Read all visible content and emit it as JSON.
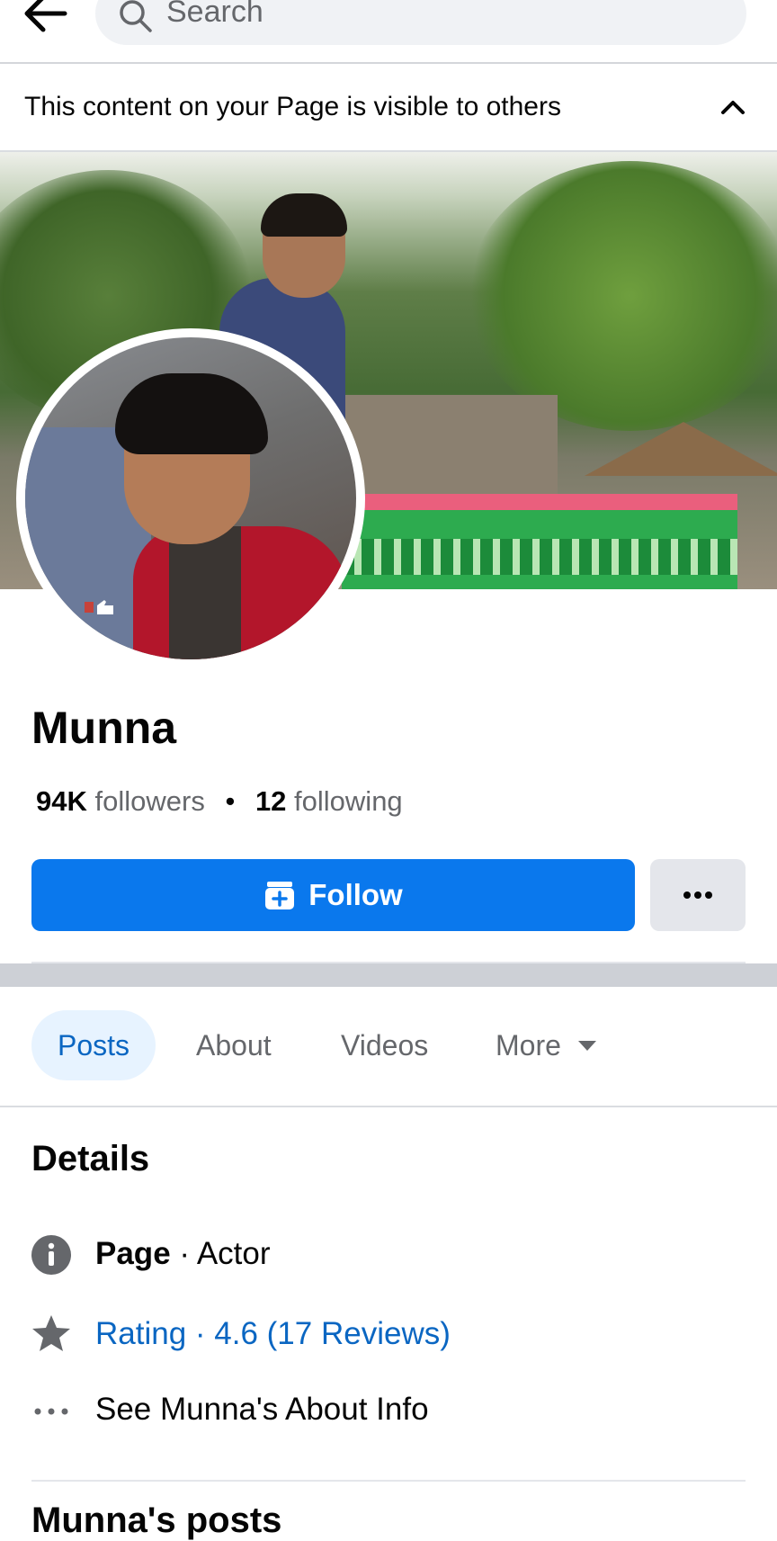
{
  "search": {
    "placeholder": "Search"
  },
  "visibility_banner": {
    "text": "This content on your Page is visible to others"
  },
  "profile": {
    "name": "Munna",
    "followers_count": "94K",
    "followers_label": "followers",
    "separator": "•",
    "following_count": "12",
    "following_label": "following"
  },
  "actions": {
    "follow_label": "Follow"
  },
  "tabs": [
    {
      "label": "Posts"
    },
    {
      "label": "About"
    },
    {
      "label": "Videos"
    },
    {
      "label": "More"
    }
  ],
  "details": {
    "title": "Details",
    "page_label": "Page",
    "page_category": " · Actor",
    "rating": "Rating · 4.6 (17 Reviews)",
    "see_about": "See Munna's About Info"
  },
  "posts_section": {
    "title": "Munna's posts"
  },
  "colors": {
    "accent": "#0a78ed",
    "link": "#0a66c2",
    "tab_active_bg": "#e7f3ff",
    "secondary_text": "#65676b"
  },
  "icons": [
    "back-arrow-icon",
    "search-icon",
    "chevron-up-icon",
    "follow-icon",
    "more-horizontal-icon",
    "caret-down-icon",
    "info-icon",
    "star-icon",
    "dots-icon"
  ]
}
